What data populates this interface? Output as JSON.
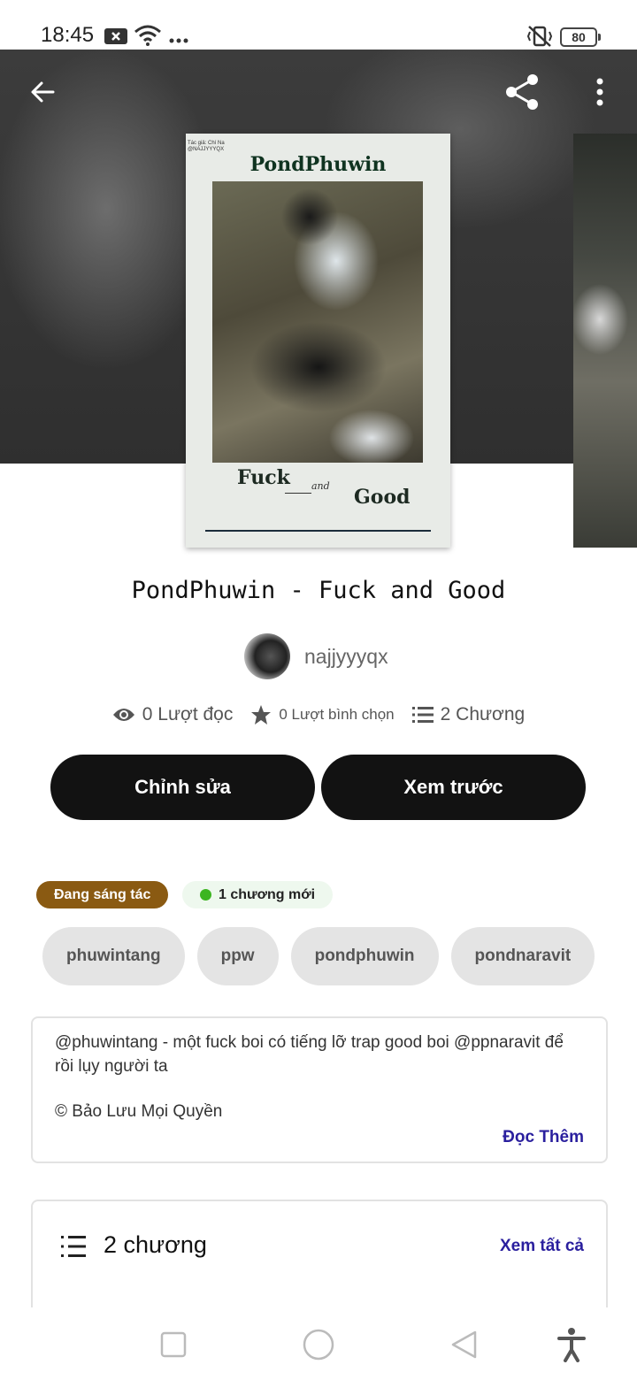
{
  "status_bar": {
    "time": "18:45",
    "battery": "80",
    "icons": [
      "notification-x-icon",
      "wifi-icon",
      "more-dots-icon",
      "vibrate-off-icon",
      "battery-icon"
    ]
  },
  "header": {
    "back_icon": "arrow-left-icon",
    "share_icon": "share-icon",
    "menu_icon": "more-vertical-icon"
  },
  "cover": {
    "title": "PondPhuwin",
    "small_text_1": "Tác giả: Chí Na",
    "small_text_2": "@NAJJYYYQX",
    "word_fuck": "Fuck",
    "word_and": "and",
    "word_good": "Good"
  },
  "story": {
    "title": "PondPhuwin - Fuck and Good",
    "author": "najjyyyqx",
    "reads": "0 Lượt đọc",
    "votes": "0 Lượt bình chọn",
    "chapters": "2 Chương"
  },
  "actions": {
    "edit_label": "Chỉnh sửa",
    "preview_label": "Xem trước"
  },
  "badges": {
    "status": "Đang sáng tác",
    "new_chapter": "1 chương mới"
  },
  "tags": [
    "phuwintang",
    "ppw",
    "pondphuwin",
    "pondnaravit"
  ],
  "description": {
    "text": "@phuwintang - một fuck boi có tiếng lỡ trap good boi @ppnaravit để rồi lụy người ta",
    "copyright": "© Bảo Lưu Mọi Quyền",
    "read_more": "Đọc Thêm"
  },
  "chapters_section": {
    "title": "2 chương",
    "see_all": "Xem tất cả"
  },
  "colors": {
    "button_bg": "#121212",
    "status_badge": "#8a5a12",
    "new_dot": "#3cb521",
    "link": "#2a1f9e"
  }
}
